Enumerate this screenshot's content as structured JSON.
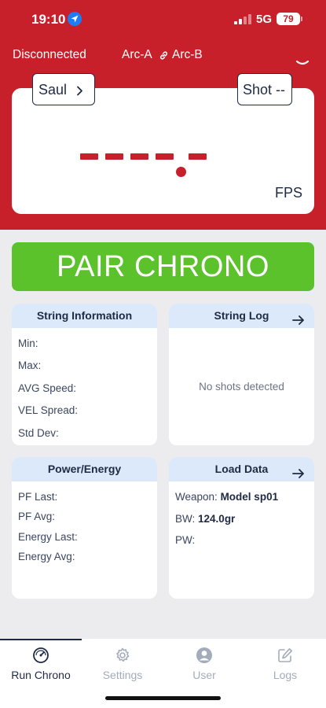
{
  "status_bar": {
    "time": "19:10",
    "network": "5G",
    "battery": "79"
  },
  "header": {
    "connection_status": "Disconnected",
    "device_a": "Arc-A",
    "device_b": "Arc-B"
  },
  "display": {
    "user_label": "Saul",
    "shot_label": "Shot --",
    "unit": "FPS"
  },
  "pair_button": {
    "label": "PAIR CHRONO"
  },
  "string_info": {
    "title": "String Information",
    "fields": [
      "Min:",
      "Max:",
      "AVG Speed:",
      "VEL Spread:",
      "Std Dev:"
    ]
  },
  "string_log": {
    "title": "String Log",
    "empty_text": "No shots detected"
  },
  "power_energy": {
    "title": "Power/Energy",
    "fields": [
      "PF Last:",
      "PF Avg:",
      "Energy Last:",
      "Energy Avg:"
    ]
  },
  "load_data": {
    "title": "Load Data",
    "weapon_label": "Weapon:",
    "weapon_value": "Model sp01",
    "bw_label": "BW:",
    "bw_value": "124.0gr",
    "pw_label": "PW:"
  },
  "nav": {
    "items": [
      {
        "label": "Run Chrono",
        "icon": "speedometer-icon",
        "active": true
      },
      {
        "label": "Settings",
        "icon": "gear-icon",
        "active": false
      },
      {
        "label": "User",
        "icon": "user-icon",
        "active": false
      },
      {
        "label": "Logs",
        "icon": "edit-icon",
        "active": false
      }
    ]
  },
  "colors": {
    "brand_red": "#c8202a",
    "pair_green": "#5cc22c",
    "card_header": "#dce9fa",
    "text_dark": "#1f2a44",
    "nav_inactive": "#a3acbb"
  }
}
